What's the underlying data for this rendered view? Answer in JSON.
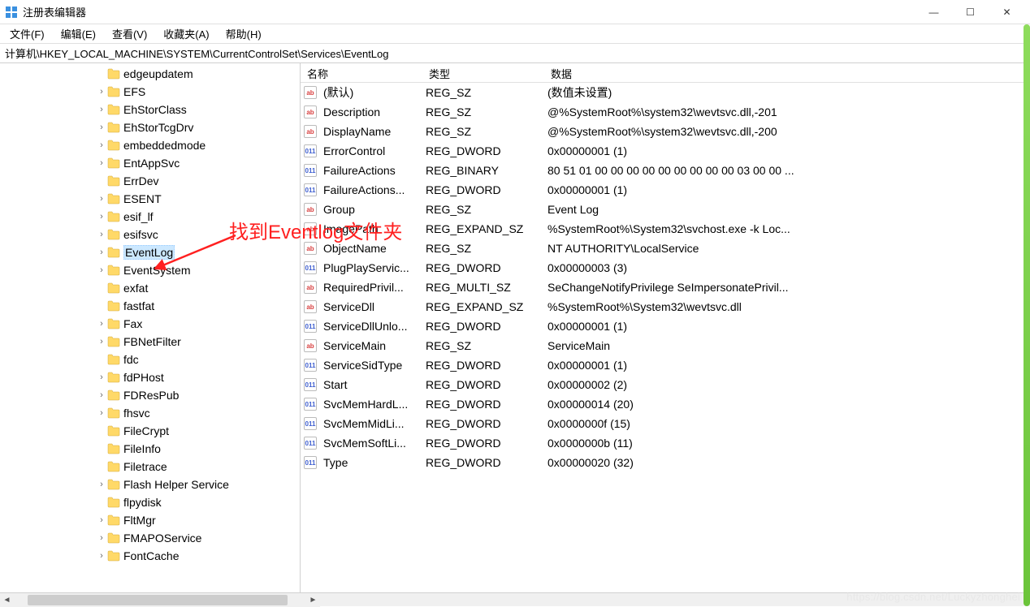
{
  "window": {
    "title": "注册表编辑器"
  },
  "menus": {
    "file": "文件(F)",
    "edit": "编辑(E)",
    "view": "查看(V)",
    "favorites": "收藏夹(A)",
    "help": "帮助(H)"
  },
  "address": "计算机\\HKEY_LOCAL_MACHINE\\SYSTEM\\CurrentControlSet\\Services\\EventLog",
  "tree": [
    {
      "label": "edgeupdatem",
      "expandable": false
    },
    {
      "label": "EFS",
      "expandable": true
    },
    {
      "label": "EhStorClass",
      "expandable": true
    },
    {
      "label": "EhStorTcgDrv",
      "expandable": true
    },
    {
      "label": "embeddedmode",
      "expandable": true
    },
    {
      "label": "EntAppSvc",
      "expandable": true
    },
    {
      "label": "ErrDev",
      "expandable": false
    },
    {
      "label": "ESENT",
      "expandable": true
    },
    {
      "label": "esif_lf",
      "expandable": true
    },
    {
      "label": "esifsvc",
      "expandable": true
    },
    {
      "label": "EventLog",
      "expandable": true,
      "selected": true
    },
    {
      "label": "EventSystem",
      "expandable": true
    },
    {
      "label": "exfat",
      "expandable": false
    },
    {
      "label": "fastfat",
      "expandable": false
    },
    {
      "label": "Fax",
      "expandable": true
    },
    {
      "label": "FBNetFilter",
      "expandable": true
    },
    {
      "label": "fdc",
      "expandable": false
    },
    {
      "label": "fdPHost",
      "expandable": true
    },
    {
      "label": "FDResPub",
      "expandable": true
    },
    {
      "label": "fhsvc",
      "expandable": true
    },
    {
      "label": "FileCrypt",
      "expandable": false
    },
    {
      "label": "FileInfo",
      "expandable": false
    },
    {
      "label": "Filetrace",
      "expandable": false
    },
    {
      "label": "Flash Helper Service",
      "expandable": true
    },
    {
      "label": "flpydisk",
      "expandable": false
    },
    {
      "label": "FltMgr",
      "expandable": true
    },
    {
      "label": "FMAPOService",
      "expandable": true
    },
    {
      "label": "FontCache",
      "expandable": true
    }
  ],
  "columns": {
    "name": "名称",
    "type": "类型",
    "data": "数据"
  },
  "values": [
    {
      "icon": "str",
      "name": "(默认)",
      "type": "REG_SZ",
      "data": "(数值未设置)"
    },
    {
      "icon": "str",
      "name": "Description",
      "type": "REG_SZ",
      "data": "@%SystemRoot%\\system32\\wevtsvc.dll,-201"
    },
    {
      "icon": "str",
      "name": "DisplayName",
      "type": "REG_SZ",
      "data": "@%SystemRoot%\\system32\\wevtsvc.dll,-200"
    },
    {
      "icon": "bin",
      "name": "ErrorControl",
      "type": "REG_DWORD",
      "data": "0x00000001 (1)"
    },
    {
      "icon": "bin",
      "name": "FailureActions",
      "type": "REG_BINARY",
      "data": "80 51 01 00 00 00 00 00 00 00 00 00 03 00 00 ..."
    },
    {
      "icon": "bin",
      "name": "FailureActions...",
      "type": "REG_DWORD",
      "data": "0x00000001 (1)"
    },
    {
      "icon": "str",
      "name": "Group",
      "type": "REG_SZ",
      "data": "Event Log"
    },
    {
      "icon": "str",
      "name": "ImagePath",
      "type": "REG_EXPAND_SZ",
      "data": "%SystemRoot%\\System32\\svchost.exe -k Loc..."
    },
    {
      "icon": "str",
      "name": "ObjectName",
      "type": "REG_SZ",
      "data": "NT AUTHORITY\\LocalService"
    },
    {
      "icon": "bin",
      "name": "PlugPlayServic...",
      "type": "REG_DWORD",
      "data": "0x00000003 (3)"
    },
    {
      "icon": "str",
      "name": "RequiredPrivil...",
      "type": "REG_MULTI_SZ",
      "data": "SeChangeNotifyPrivilege SeImpersonatePrivil..."
    },
    {
      "icon": "str",
      "name": "ServiceDll",
      "type": "REG_EXPAND_SZ",
      "data": "%SystemRoot%\\System32\\wevtsvc.dll"
    },
    {
      "icon": "bin",
      "name": "ServiceDllUnlo...",
      "type": "REG_DWORD",
      "data": "0x00000001 (1)"
    },
    {
      "icon": "str",
      "name": "ServiceMain",
      "type": "REG_SZ",
      "data": "ServiceMain"
    },
    {
      "icon": "bin",
      "name": "ServiceSidType",
      "type": "REG_DWORD",
      "data": "0x00000001 (1)"
    },
    {
      "icon": "bin",
      "name": "Start",
      "type": "REG_DWORD",
      "data": "0x00000002 (2)"
    },
    {
      "icon": "bin",
      "name": "SvcMemHardL...",
      "type": "REG_DWORD",
      "data": "0x00000014 (20)"
    },
    {
      "icon": "bin",
      "name": "SvcMemMidLi...",
      "type": "REG_DWORD",
      "data": "0x0000000f (15)"
    },
    {
      "icon": "bin",
      "name": "SvcMemSoftLi...",
      "type": "REG_DWORD",
      "data": "0x0000000b (11)"
    },
    {
      "icon": "bin",
      "name": "Type",
      "type": "REG_DWORD",
      "data": "0x00000020 (32)"
    }
  ],
  "annotation": "找到Eventlog文件夹",
  "watermark": "https://blog.csdn.net/Luckyzhonghei"
}
